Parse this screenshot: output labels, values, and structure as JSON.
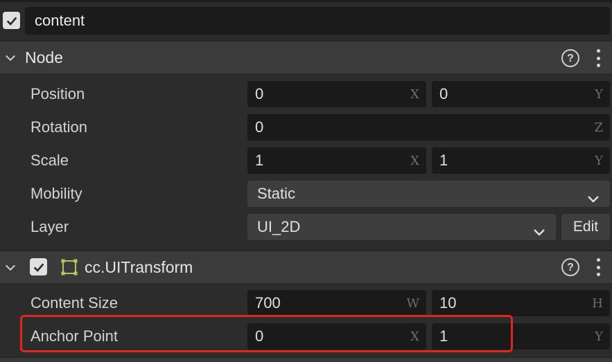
{
  "node_name": {
    "value": "content",
    "enabled": true
  },
  "node_section": {
    "title": "Node",
    "rows": {
      "position": {
        "label": "Position",
        "x": "0",
        "x_suffix": "X",
        "y": "0",
        "y_suffix": "Y"
      },
      "rotation": {
        "label": "Rotation",
        "z": "0",
        "z_suffix": "Z"
      },
      "scale": {
        "label": "Scale",
        "x": "1",
        "x_suffix": "X",
        "y": "1",
        "y_suffix": "Y"
      },
      "mobility": {
        "label": "Mobility",
        "value": "Static"
      },
      "layer": {
        "label": "Layer",
        "value": "UI_2D",
        "edit_label": "Edit"
      }
    }
  },
  "uitransform_section": {
    "title": "cc.UITransform",
    "enabled": true,
    "rows": {
      "content_size": {
        "label": "Content Size",
        "w": "700",
        "w_suffix": "W",
        "h": "10",
        "h_suffix": "H"
      },
      "anchor_point": {
        "label": "Anchor Point",
        "x": "0",
        "x_suffix": "X",
        "y": "1",
        "y_suffix": "Y"
      }
    }
  },
  "icons": {
    "help": "help-circle-icon",
    "more": "more-vertical-icon",
    "collapse": "chevron-down-icon",
    "component": "uitransform-bracket-icon"
  },
  "colors": {
    "field_bg": "#1a1a1a",
    "header_bg": "#3b3b3b",
    "highlight": "#e0261f",
    "component_icon": "#b8c55a"
  }
}
